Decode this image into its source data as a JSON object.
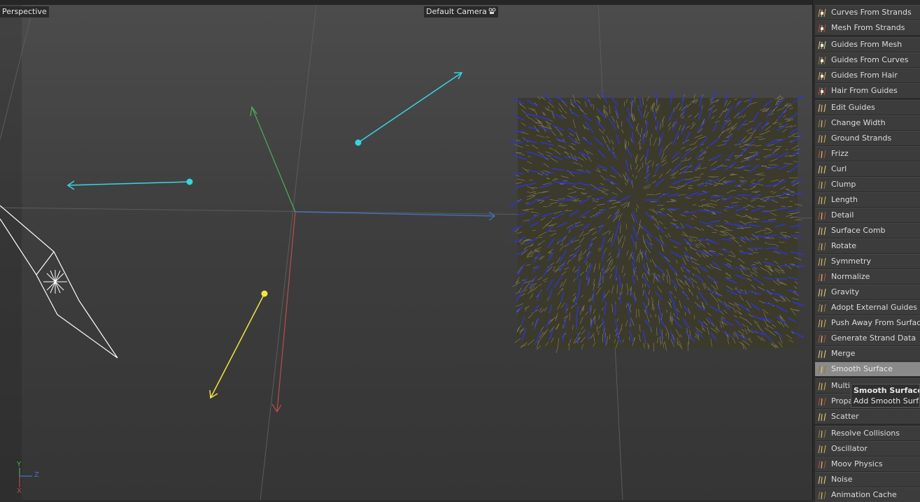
{
  "viewport": {
    "view_label": "Perspective",
    "camera_label": "Default Camera",
    "camera_icon": "camera-settings-icon",
    "axis_gizmo": {
      "y": "Y",
      "z": "Z",
      "x": "X"
    },
    "colors": {
      "x_axis": "#c24a4a",
      "y_axis": "#4fae58",
      "z_axis": "#3f76c8",
      "light_arrow": "#36d6e0",
      "light_arrow_yellow": "#f2e63a",
      "hair": "#a29b6a",
      "guides": "#2a35e0"
    }
  },
  "panel": {
    "items": [
      {
        "label": "Curves From Strands",
        "icon": "curves-from-strands-icon"
      },
      {
        "label": "Mesh From Strands",
        "icon": "mesh-from-strands-icon"
      },
      {
        "label": "Guides From Mesh",
        "icon": "guides-from-mesh-icon"
      },
      {
        "label": "Guides From Curves",
        "icon": "guides-from-curves-icon"
      },
      {
        "label": "Guides From Hair",
        "icon": "guides-from-hair-icon"
      },
      {
        "label": "Hair From Guides",
        "icon": "hair-from-guides-icon"
      },
      {
        "label": "Edit Guides",
        "icon": "edit-guides-icon"
      },
      {
        "label": "Change Width",
        "icon": "change-width-icon"
      },
      {
        "label": "Ground Strands",
        "icon": "ground-strands-icon"
      },
      {
        "label": "Frizz",
        "icon": "frizz-icon"
      },
      {
        "label": "Curl",
        "icon": "curl-icon"
      },
      {
        "label": "Clump",
        "icon": "clump-icon"
      },
      {
        "label": "Length",
        "icon": "length-icon"
      },
      {
        "label": "Detail",
        "icon": "detail-icon"
      },
      {
        "label": "Surface Comb",
        "icon": "surface-comb-icon"
      },
      {
        "label": "Rotate",
        "icon": "rotate-icon"
      },
      {
        "label": "Symmetry",
        "icon": "symmetry-icon"
      },
      {
        "label": "Normalize",
        "icon": "normalize-icon"
      },
      {
        "label": "Gravity",
        "icon": "gravity-icon"
      },
      {
        "label": "Adopt External Guides",
        "icon": "adopt-external-guides-icon"
      },
      {
        "label": "Push Away From Surface",
        "icon": "push-away-from-surface-icon"
      },
      {
        "label": "Generate Strand Data",
        "icon": "generate-strand-data-icon"
      },
      {
        "label": "Merge",
        "icon": "merge-icon"
      },
      {
        "label": "Smooth Surface",
        "icon": "smooth-surface-icon",
        "highlighted": true
      },
      {
        "label": "Multi",
        "icon": "multi-icon"
      },
      {
        "label": "Propa",
        "icon": "propagate-icon"
      },
      {
        "label": "Scatter",
        "icon": "scatter-icon"
      },
      {
        "label": "Resolve Collisions",
        "icon": "resolve-collisions-icon"
      },
      {
        "label": "Oscillator",
        "icon": "oscillator-icon"
      },
      {
        "label": "Moov Physics",
        "icon": "moov-physics-icon"
      },
      {
        "label": "Noise",
        "icon": "noise-icon"
      },
      {
        "label": "Animation Cache",
        "icon": "animation-cache-icon"
      }
    ]
  },
  "tooltip": {
    "title": "Smooth Surface",
    "description": "Add Smooth Surfac"
  }
}
